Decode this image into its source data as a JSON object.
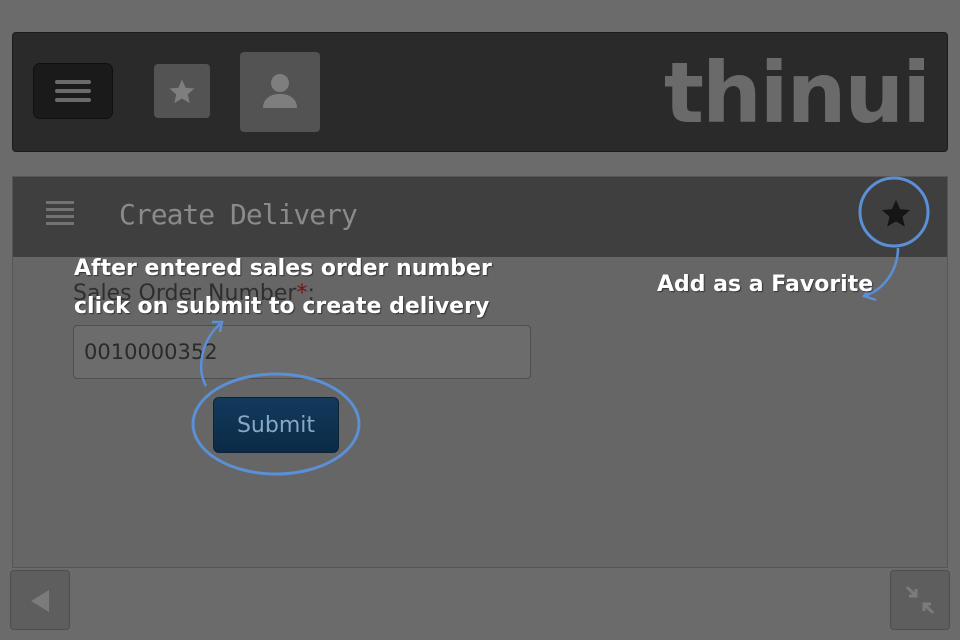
{
  "header": {
    "menu_icon": "hamburger-icon",
    "favorites_icon": "star-icon",
    "profile_icon": "user-icon",
    "logo_text": "thinui"
  },
  "panel": {
    "menu_icon": "list-icon",
    "title": "Create Delivery",
    "favorite_icon": "star-icon"
  },
  "form": {
    "label": "Sales Order Number",
    "required_mark": "*",
    "label_suffix": ":",
    "input_value": "0010000352",
    "submit_label": "Submit"
  },
  "footer": {
    "back_icon": "back-arrow-icon",
    "collapse_icon": "collapse-icon"
  },
  "annotations": {
    "instruction_line1": "After entered sales order number",
    "instruction_line2": "click on submit to create delivery",
    "favorite_note": "Add as a Favorite",
    "highlight_color": "#5b8fd6"
  }
}
